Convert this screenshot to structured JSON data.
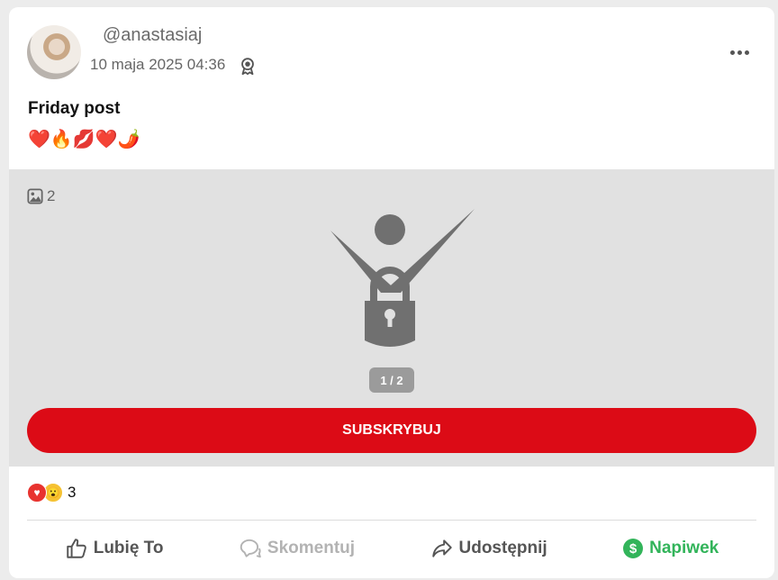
{
  "post": {
    "username": "@anastasiaj",
    "date": "10 maja 2025 04:36",
    "text": "Friday post",
    "emojis": "❤️🔥💋❤️🌶️"
  },
  "media": {
    "image_count": "2",
    "pager": "1 / 2",
    "subscribe_label": "SUBSKRYBUJ"
  },
  "reactions": {
    "count": "3"
  },
  "actions": {
    "like": "Lubię To",
    "comment": "Skomentuj",
    "share": "Udostępnij",
    "tip": "Napiwek"
  },
  "colors": {
    "brand_red": "#dc0b16",
    "tip_green": "#32b45a",
    "media_bg": "#e1e1e1"
  },
  "icons": [
    "avatar",
    "award-badge-icon",
    "more-icon",
    "image-icon",
    "lock-icon",
    "heart-reaction-icon",
    "wow-reaction-icon",
    "thumbs-up-icon",
    "comment-icon",
    "share-icon",
    "dollar-icon"
  ]
}
